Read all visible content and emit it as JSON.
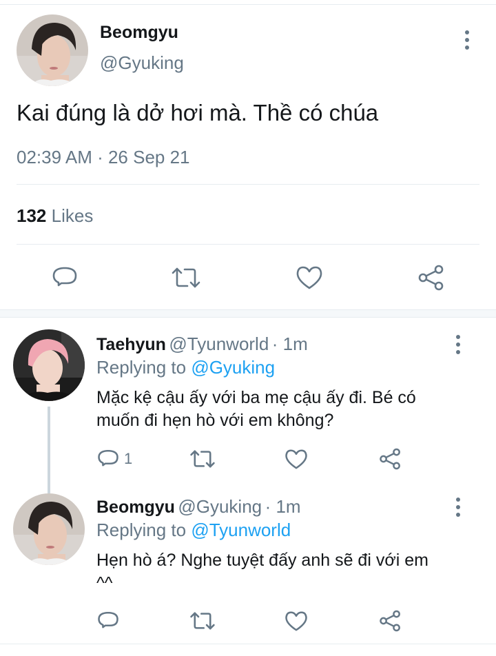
{
  "main_tweet": {
    "name": "Beomgyu",
    "handle": "@Gyuking",
    "text": "Kai đúng là dở hơi mà. Thề có chúa",
    "timestamp": "02:39 AM · 26 Sep 21",
    "likes_count": "132",
    "likes_label": "Likes"
  },
  "replies": [
    {
      "name": "Taehyun",
      "handle": "@Tyunworld",
      "time": "· 1m",
      "replying_prefix": "Replying to",
      "replying_to": "@Gyuking",
      "text_line1": "Mặc kệ cậu ấy với ba mẹ cậu ấy đi. Bé có",
      "text_line2": "muốn đi hẹn hò với em không?",
      "reply_count": "1"
    },
    {
      "name": "Beomgyu",
      "handle": "@Gyuking",
      "time": "· 1m",
      "replying_prefix": "Replying to",
      "replying_to": "@Tyunworld",
      "text_line1": "Hẹn hò á? Nghe tuyệt đấy anh sẽ đi với em",
      "text_line2": "^^",
      "reply_count": ""
    }
  ],
  "icons": [
    "reply-icon",
    "retweet-icon",
    "like-icon",
    "share-icon",
    "more-options-icon"
  ],
  "colors": {
    "text": "#14171a",
    "secondary": "#657786",
    "link": "#1da1f2",
    "divider": "#e6ecf0"
  }
}
